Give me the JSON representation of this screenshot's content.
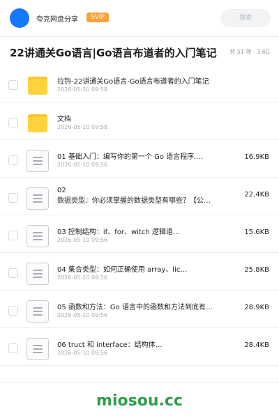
{
  "header": {
    "user_name": "夸克网盘分享",
    "badge": "SVIP",
    "search_placeholder": "搜索"
  },
  "folder": {
    "title": "22讲通关Go语言|Go语言布道者的入门笔记",
    "meta": "共 51 项 · 3.6G"
  },
  "files": [
    {
      "type": "folder",
      "name": "拉钩-22讲通关Go语言-Go语言布道者的入门笔记",
      "date": "2026-05-10 09:58",
      "size": ""
    },
    {
      "type": "folder",
      "name": "文档",
      "date": "2026-05-10 09:58",
      "size": ""
    },
    {
      "type": "doc",
      "name": "01  基础入门：编写你的第一个 Go 语言程序.…",
      "date": "2026-05-10 09:56",
      "size": "16.9KB"
    },
    {
      "type": "doc",
      "name": "02\n数据类型：你必须掌握的数据类型有哪些？【公…",
      "date": "2026-05-10 09:56",
      "size": "22.4KB",
      "multi": true
    },
    {
      "type": "doc",
      "name": "03  控制结构：if、for、witch 逻辑语…",
      "date": "2026-05-10 09:56",
      "size": "15.6KB"
    },
    {
      "type": "doc",
      "name": "04  集合类型：如何正确使用 array、lic…",
      "date": "2026-05-10 09:56",
      "size": "25.8KB"
    },
    {
      "type": "doc",
      "name": "05  函数和方法：Go 语言中的函数和方法到底有…",
      "date": "2026-05-10 09:56",
      "size": "28.9KB"
    },
    {
      "type": "doc",
      "name": "06  truct 和 interface：结构体…",
      "date": "2026-05-10 09:56",
      "size": "28.4KB"
    }
  ],
  "watermark": "miosou.cc"
}
